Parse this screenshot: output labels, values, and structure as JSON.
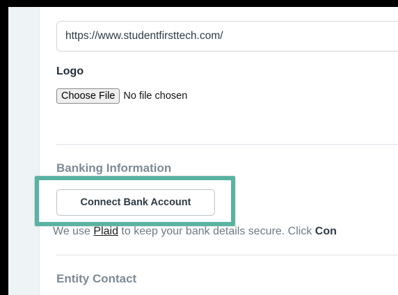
{
  "website": {
    "value": "https://www.studentfirsttech.com/"
  },
  "logo": {
    "label": "Logo",
    "choose_file_label": "Choose File",
    "file_status": "No file chosen"
  },
  "banking": {
    "title": "Banking Information",
    "connect_button_label": "Connect Bank Account",
    "note_prefix": "We use ",
    "note_link": "Plaid",
    "note_middle": " to keep your bank details secure. Click ",
    "note_bold": "Con"
  },
  "entity_contact": {
    "title": "Entity Contact"
  },
  "colors": {
    "highlight": "#5ab3a2",
    "section_title": "#7d8a95",
    "sidebar": "#eef3f6"
  }
}
